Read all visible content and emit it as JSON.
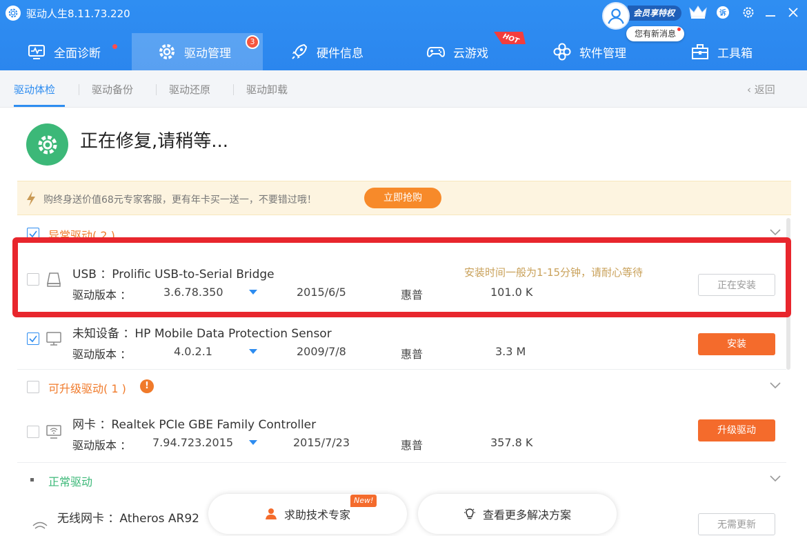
{
  "app": {
    "title": "驱动人生8.11.73.220"
  },
  "vip": {
    "banner": "会员享特权",
    "message": "您有新消息"
  },
  "tabs": [
    {
      "label": "全面诊断",
      "icon": "monitor-icon"
    },
    {
      "label": "驱动管理",
      "icon": "gear-icon",
      "badge": "3"
    },
    {
      "label": "硬件信息",
      "icon": "rocket-icon"
    },
    {
      "label": "云游戏",
      "icon": "gamepad-icon",
      "tag": "HOT"
    },
    {
      "label": "软件管理",
      "icon": "apps-icon"
    },
    {
      "label": "工具箱",
      "icon": "toolbox-icon"
    }
  ],
  "subnav": {
    "items": [
      "驱动体检",
      "驱动备份",
      "驱动还原",
      "驱动卸载"
    ],
    "back": "返回"
  },
  "status": {
    "title": "正在修复,请稍等..."
  },
  "promo": {
    "text": "购终身送价值68元专家客服，更有年卡买一送一，不要错过哦！",
    "button": "立即抢购"
  },
  "sections": {
    "abnormal": {
      "title": "异常驱动( 2 )"
    },
    "upgradable": {
      "title": "可升级驱动( 1 )"
    },
    "normal": {
      "title": "正常驱动"
    }
  },
  "version_label": "驱动版本 ：",
  "rows": [
    {
      "name": "USB ：Prolific USB-to-Serial Bridge",
      "version": "3.6.78.350",
      "date": "2015/6/5",
      "vendor": "惠普",
      "size": "101.0 K",
      "hint": "安装时间一般为1-15分钟，请耐心等待",
      "button": "正在安装",
      "checked": false
    },
    {
      "name": "未知设备 ：HP Mobile Data Protection Sensor",
      "version": "4.0.2.1",
      "date": "2009/7/8",
      "vendor": "惠普",
      "size": "3.3 M",
      "button": "安装",
      "checked": true
    },
    {
      "name": "网卡 ：Realtek PCIe GBE Family Controller",
      "version": "7.94.723.2015",
      "date": "2015/7/23",
      "vendor": "惠普",
      "size": "357.8 K",
      "button": "升级驱动",
      "checked": false
    },
    {
      "name": "无线网卡 ：Atheros AR92",
      "button": "无需更新"
    }
  ],
  "bottom": {
    "help": "求助技术专家",
    "help_tag": "New!",
    "more": "查看更多解决方案"
  },
  "colors": {
    "header_blue": "#2d8cf0",
    "status_green": "#3cb878",
    "section_orange": "#f07a2a",
    "button_orange": "#f46b2c",
    "highlight_red": "#e8262d"
  }
}
